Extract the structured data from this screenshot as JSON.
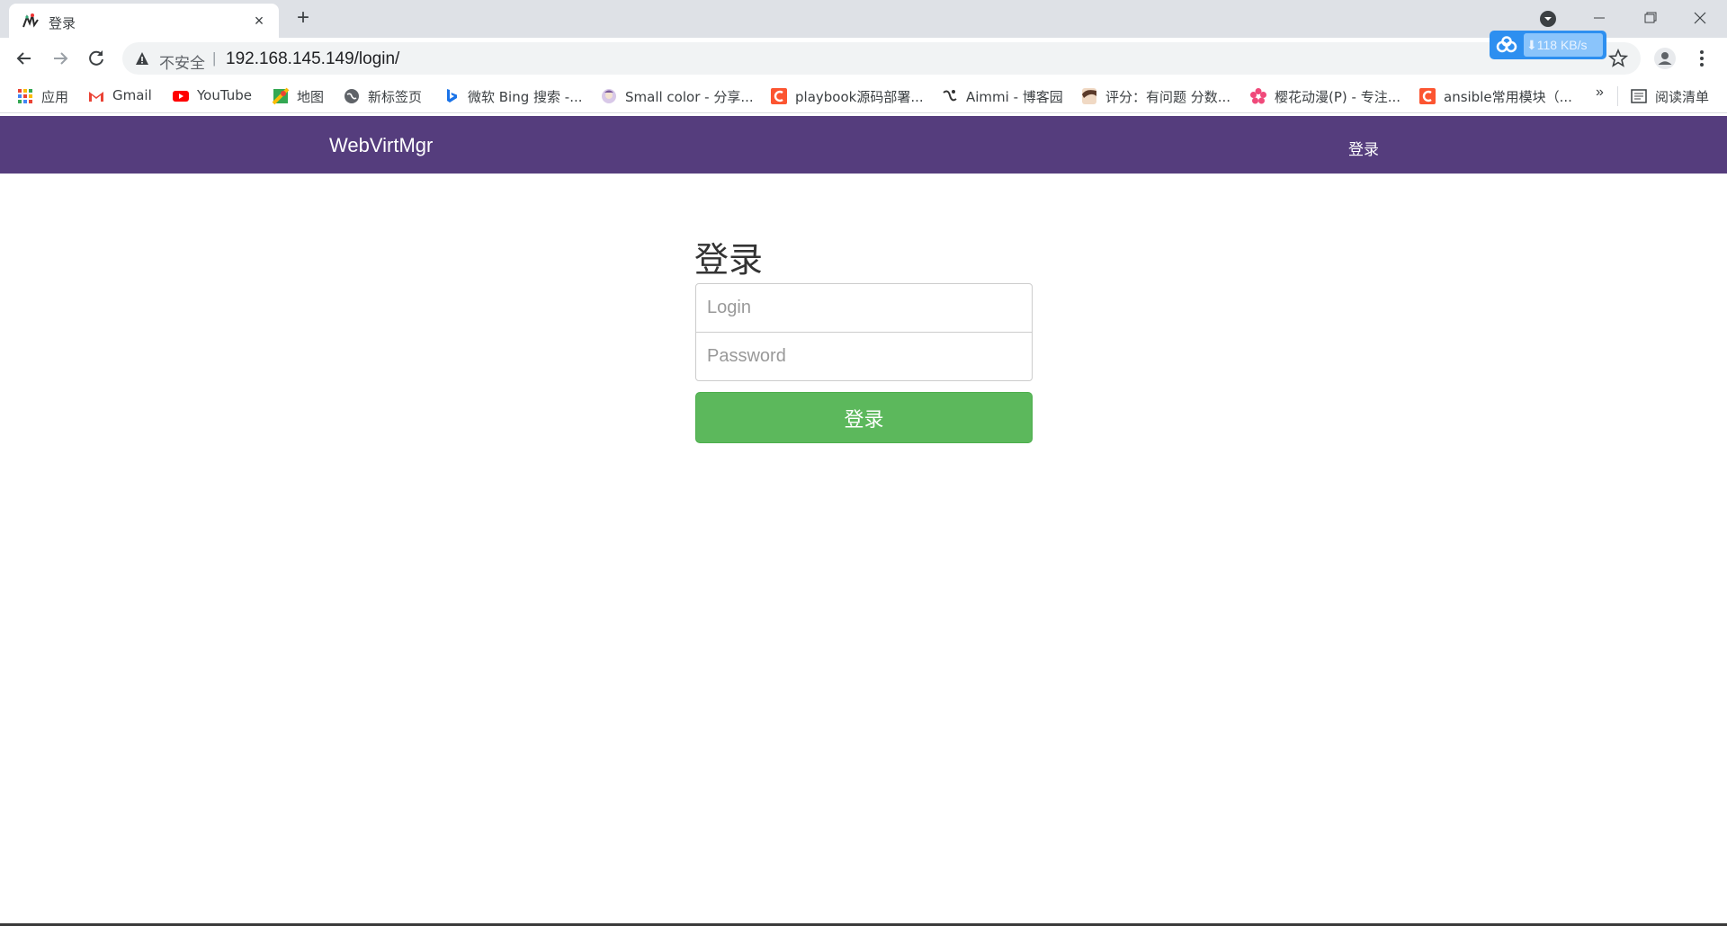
{
  "browser": {
    "tab": {
      "title": "登录",
      "close_glyph": "×"
    },
    "new_tab_glyph": "+",
    "address": {
      "security_label": "不安全",
      "separator": "|",
      "url": "192.168.145.149/login/"
    },
    "extension": {
      "speed": "⬇118 KB/s",
      "icon": "baidu-cloud-icon",
      "color": "#2d8ff0"
    },
    "bookmarks": [
      {
        "label": "应用",
        "icon": "apps-grid-icon"
      },
      {
        "label": "Gmail",
        "icon": "gmail-icon"
      },
      {
        "label": "YouTube",
        "icon": "youtube-icon"
      },
      {
        "label": "地图",
        "icon": "maps-icon"
      },
      {
        "label": "新标签页",
        "icon": "globe-icon"
      },
      {
        "label": "微软 Bing 搜索 -...",
        "icon": "bing-icon"
      },
      {
        "label": "Small color - 分享...",
        "icon": "avatar-icon"
      },
      {
        "label": "playbook源码部署...",
        "icon": "csdn-icon"
      },
      {
        "label": "Aimmi - 博客园",
        "icon": "cnblogs-icon"
      },
      {
        "label": "评分：有问题 分数...",
        "icon": "anime-icon"
      },
      {
        "label": "樱花动漫(P) - 专注...",
        "icon": "flower-icon"
      },
      {
        "label": "ansible常用模块（...",
        "icon": "csdn-icon"
      }
    ],
    "bookmarks_more": "»",
    "reading_list": {
      "label": "阅读清单",
      "icon": "reading-list-icon"
    }
  },
  "page": {
    "brand": "WebVirtMgr",
    "nav_login": "登录",
    "heading": "登录",
    "login_placeholder": "Login",
    "password_placeholder": "Password",
    "submit_label": "登录",
    "colors": {
      "navbar": "#553d7d",
      "button": "#5cb85c"
    }
  }
}
